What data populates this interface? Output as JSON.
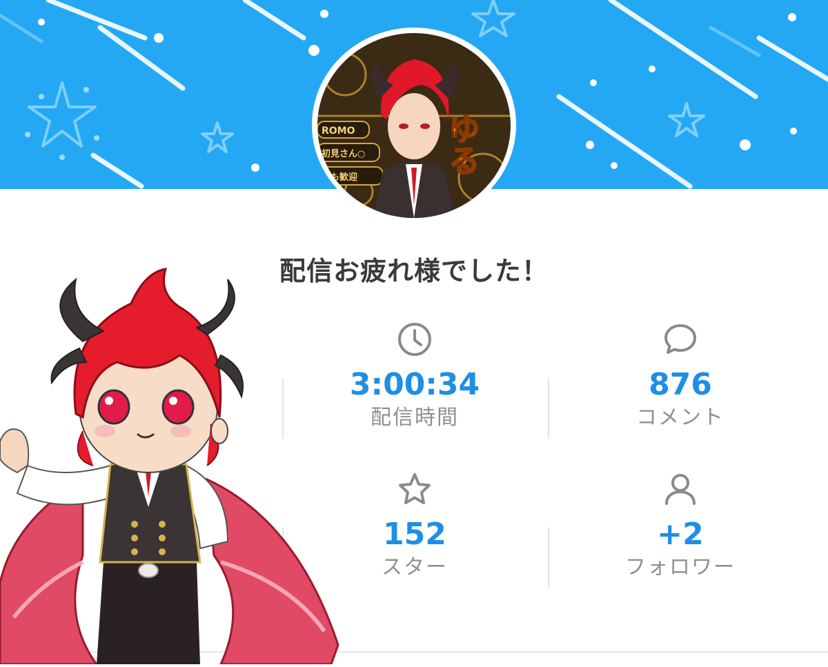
{
  "header": {
    "banner_color": "#25a8f4",
    "avatar_text": "ゆる",
    "avatar_badges": [
      "ROMO",
      "初見さん○",
      "でも歓迎"
    ]
  },
  "title": "配信お疲れ様でした！",
  "stats": [
    {
      "icon": "clock-icon",
      "value": "3:00:34",
      "label": "配信時間"
    },
    {
      "icon": "comment-icon",
      "value": "876",
      "label": "コメント"
    },
    {
      "icon": "star-icon",
      "value": "152",
      "label": "スター"
    },
    {
      "icon": "person-icon",
      "value": "+2",
      "label": "フォロワー"
    }
  ],
  "colors": {
    "accent": "#1f8ee6",
    "label": "#8f8f8f",
    "title": "#3a3a3a"
  }
}
